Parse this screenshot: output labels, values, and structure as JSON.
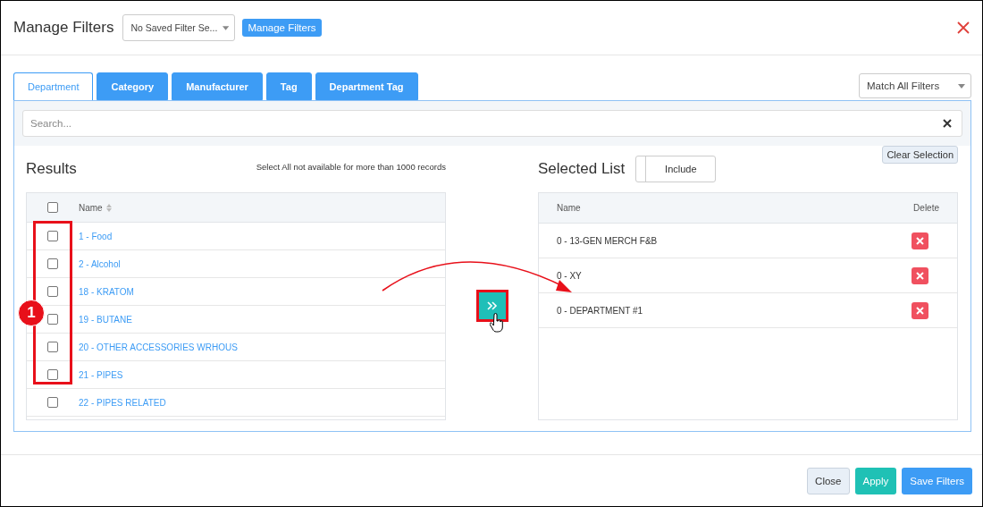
{
  "header": {
    "title": "Manage Filters",
    "saved_filter_select": {
      "value": "No Saved Filter Se..."
    },
    "manage_button": "Manage Filters"
  },
  "tabs": [
    {
      "label": "Department",
      "selected": true
    },
    {
      "label": "Category",
      "selected": false
    },
    {
      "label": "Manufacturer",
      "selected": false
    },
    {
      "label": "Tag",
      "selected": false
    },
    {
      "label": "Department Tag",
      "selected": false
    }
  ],
  "match_select": {
    "value": "Match All Filters"
  },
  "search": {
    "placeholder": "Search..."
  },
  "results": {
    "title": "Results",
    "note": "Select All not available for more than 1000 records",
    "column": "Name",
    "select_all_checked": false,
    "rows": [
      {
        "name": "1 - Food",
        "checked": false
      },
      {
        "name": "2 - Alcohol",
        "checked": false
      },
      {
        "name": "18 - KRATOM",
        "checked": false
      },
      {
        "name": "19 - BUTANE",
        "checked": false
      },
      {
        "name": "20 - OTHER ACCESSORIES WRHOUS",
        "checked": false
      },
      {
        "name": "21 - PIPES",
        "checked": false
      },
      {
        "name": "22 - PIPES RELATED",
        "checked": false
      }
    ]
  },
  "selected_list": {
    "title": "Selected List",
    "mode_toggle": "Include",
    "clear_button": "Clear Selection",
    "columns": [
      "Name",
      "Delete"
    ],
    "rows": [
      {
        "name": "0 - 13-GEN MERCH F&B"
      },
      {
        "name": "0 - XY"
      },
      {
        "name": "0 - DEPARTMENT #1"
      }
    ]
  },
  "annotation": {
    "badge": "1"
  },
  "footer": {
    "buttons": [
      {
        "label": "Close",
        "kind": "default"
      },
      {
        "label": "Apply",
        "kind": "success"
      },
      {
        "label": "Save Filters",
        "kind": "primary"
      }
    ]
  }
}
